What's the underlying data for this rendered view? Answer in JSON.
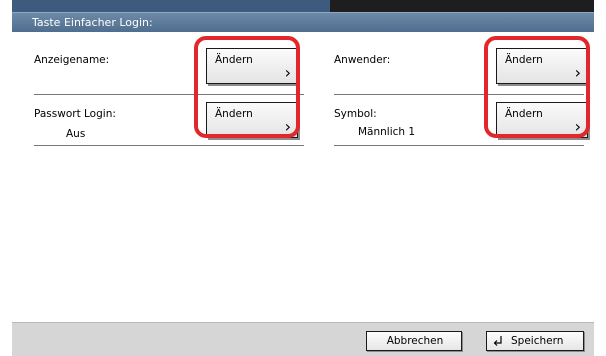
{
  "window": {
    "title": "Taste Einfacher Login:"
  },
  "settings": [
    {
      "label": "Anzeigename:",
      "value": "",
      "button_label": "Ändern",
      "button_icon": "chevron-right-icon"
    },
    {
      "label": "Anwender:",
      "value": "",
      "button_label": "Ändern",
      "button_icon": "chevron-right-icon"
    },
    {
      "label": "Passwort Login:",
      "value": "Aus",
      "button_label": "Ändern",
      "button_icon": "chevron-right-icon"
    },
    {
      "label": "Symbol:",
      "value": "Männlich 1",
      "button_label": "Ändern",
      "button_icon": "chevron-right-icon"
    }
  ],
  "footer": {
    "cancel_label": "Abbrechen",
    "save_label": "Speichern",
    "save_icon": "enter-return-icon"
  },
  "colors": {
    "highlight": "#e2272c",
    "titlebar": "#5a7898",
    "footer": "#d6d6d6"
  }
}
